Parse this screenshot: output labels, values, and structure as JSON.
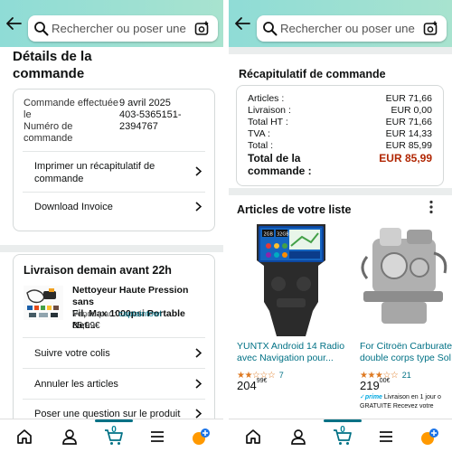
{
  "search": {
    "placeholder": "Rechercher ou poser une..."
  },
  "left": {
    "order_details": {
      "title_line1": "Détails de la",
      "title_line2": "commande",
      "ordered_label_line1": "Commande effectuée",
      "ordered_label_line2": "le",
      "ordered_date": "9 avril 2025",
      "order_number_label_line1": "Numéro de",
      "order_number_label_line2": "commande",
      "order_number_line1": "403-5365151-",
      "order_number_line2": "2394767",
      "print_summary_line1": "Imprimer un récapitulatif de",
      "print_summary_line2": "commande",
      "download_invoice": "Download Invoice"
    },
    "delivery": {
      "title": "Livraison demain avant 22h",
      "product_line1": "Nettoyeur Haute Pression sans",
      "product_line2": "Fil, Max 1000psi Portable Net...",
      "sold_by_label": "Vendu par :",
      "seller": "captaintowl",
      "price": "85,99€",
      "track": "Suivre votre colis",
      "cancel": "Annuler les articles",
      "question": "Poser une question sur le produit"
    }
  },
  "right": {
    "summary": {
      "title": "Récapitulatif de commande",
      "rows": [
        {
          "label": "Articles :",
          "value": "EUR 71,66"
        },
        {
          "label": "Livraison :",
          "value": "EUR 0,00"
        },
        {
          "label": "Total HT :",
          "value": "EUR 71,66"
        },
        {
          "label": "TVA :",
          "value": "EUR 14,33"
        },
        {
          "label": "Total :",
          "value": "EUR 85,99"
        }
      ],
      "grand_total_label_line1": "Total de la",
      "grand_total_label_line2": "commande :",
      "grand_total_value": "EUR 85,99"
    },
    "list": {
      "title": "Articles de votre liste",
      "products": [
        {
          "title_line1": "YUNTX Android 14 Radio",
          "title_line2": "avec Navigation pour...",
          "rating": 2.5,
          "reviews": "7",
          "price_whole": "204",
          "price_cents": "99€"
        },
        {
          "title_line1": "For Citroën Carburate",
          "title_line2": "double corps type Sol",
          "rating": 3.5,
          "reviews": "21",
          "price_whole": "219",
          "price_cents": "00€",
          "prime_label": "prime",
          "delivery_line1": "Livraison en 1 jour o",
          "delivery_line2": "GRATUITE Recevez votre"
        }
      ],
      "screen_labels": [
        "2GB",
        "32GB"
      ]
    }
  },
  "nav": {
    "cart_count": "0"
  },
  "colors": {
    "accent": "#007185",
    "price_red": "#b12704",
    "star": "#de7921",
    "header": "#a2e1d4"
  }
}
